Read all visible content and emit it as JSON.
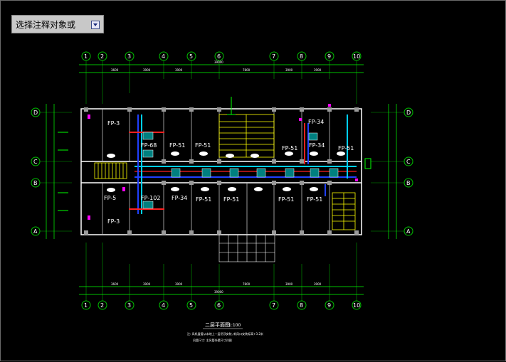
{
  "command_prompt": {
    "text": "选择注释对象或"
  },
  "axes": {
    "numbers": [
      "1",
      "2",
      "3",
      "4",
      "5",
      "6",
      "7",
      "8",
      "9",
      "10"
    ],
    "letters": [
      "D",
      "C",
      "B",
      "A"
    ]
  },
  "room_labels": {
    "fp_68": "FP-68",
    "fp_51_a": "FP-51",
    "fp_51_b": "FP-51",
    "fp_51_c": "FP-51",
    "fp_51_d": "FP-51",
    "fp_34_a": "FP-34",
    "fp_34_b": "FP-34",
    "fp_34_c": "FP-34",
    "fp_102": "FP-102",
    "fp_51_e": "FP-51",
    "fp_51_f": "FP-51",
    "fp_51_g": "FP-51",
    "fp_51_h": "FP-51",
    "fp_3_top": "FP-3",
    "fp_3_bot": "FP-3",
    "fp_5_left": "FP-5"
  },
  "drawing": {
    "title": "二层平面图",
    "scale": "1:100",
    "note_line1": "注: 风机盘管从本地上一层吊顶安装, 新风口安装标高+3.2米",
    "note_line2": "风管尺寸: 主风管外壁尺寸详图"
  },
  "colors": {
    "background": "#000000",
    "wall": "#ffffff",
    "grid": "#00c000",
    "duct_red": "#ff2020",
    "pipe_cyan": "#00d0ff",
    "pipe_blue": "#2040ff",
    "stair_yellow": "#ffff00",
    "dim_green": "#00ff00",
    "magenta": "#ff00ff"
  }
}
